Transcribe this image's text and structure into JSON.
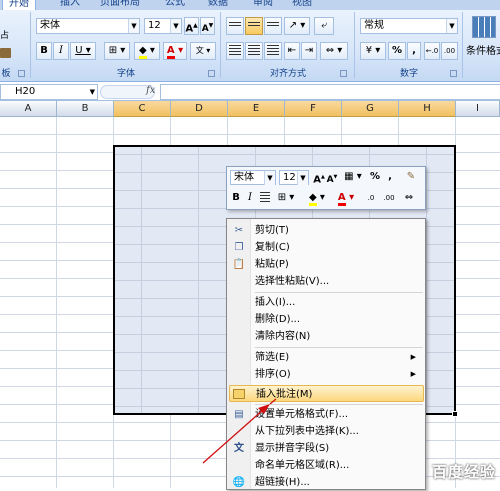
{
  "ribbon": {
    "tabs": [
      "开始",
      "插入",
      "页面布局",
      "公式",
      "数据",
      "审阅",
      "视图"
    ],
    "paste_group_label": "板",
    "font_name": "宋体",
    "font_size": "12",
    "font_group_label": "字体",
    "align_group_label": "对齐方式",
    "number_format": "常规",
    "number_group_label": "数字",
    "cond_format_label": "条件格式",
    "percent_glyph": "%",
    "comma_glyph": ","
  },
  "formula_bar": {
    "cell_ref": "H20",
    "fx_label": "fx",
    "formula": ""
  },
  "columns": [
    "A",
    "B",
    "C",
    "D",
    "E",
    "F",
    "G",
    "H",
    "I"
  ],
  "mini_toolbar": {
    "font_name": "宋体",
    "font_size": "12",
    "percent_glyph": "%",
    "comma_glyph": ","
  },
  "context_menu": {
    "items": [
      {
        "label": "剪切(T)",
        "icon": "scissors-icon"
      },
      {
        "label": "复制(C)",
        "icon": "copy-icon"
      },
      {
        "label": "粘贴(P)",
        "icon": "paste-icon"
      },
      {
        "label": "选择性粘贴(V)...",
        "icon": ""
      },
      {
        "label": "插入(I)...",
        "icon": ""
      },
      {
        "label": "删除(D)...",
        "icon": ""
      },
      {
        "label": "清除内容(N)",
        "icon": ""
      },
      {
        "label": "筛选(E)",
        "icon": "",
        "submenu": true
      },
      {
        "label": "排序(O)",
        "icon": "",
        "submenu": true
      },
      {
        "label": "插入批注(M)",
        "icon": "comment-icon",
        "highlighted": true
      },
      {
        "label": "设置单元格格式(F)...",
        "icon": "format-cells-icon"
      },
      {
        "label": "从下拉列表中选择(K)...",
        "icon": ""
      },
      {
        "label": "显示拼音字段(S)",
        "icon": "phonetic-icon"
      },
      {
        "label": "命名单元格区域(R)...",
        "icon": ""
      },
      {
        "label": "超链接(H)...",
        "icon": "hyperlink-icon"
      }
    ]
  },
  "watermark": "百度经验",
  "colors": {
    "selection_fill": "#e3e9f4",
    "menu_highlight": "#fbd77f",
    "arrow": "#d01010",
    "ribbon_text": "#15428b"
  }
}
